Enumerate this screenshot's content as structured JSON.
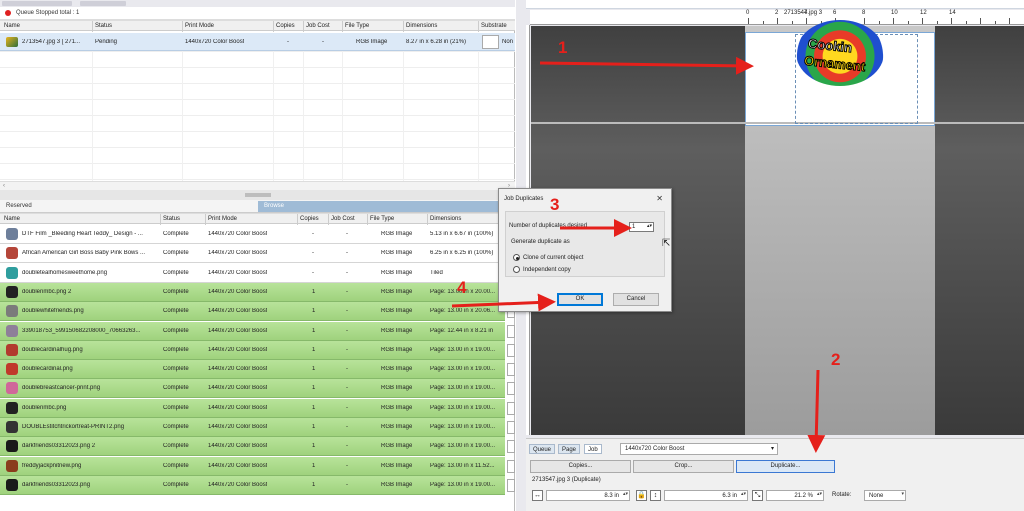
{
  "queue": {
    "status_text": "Queue Stopped   total : 1",
    "columns": [
      "Name",
      "Status",
      "Print Mode",
      "Copies",
      "Job Cost",
      "File Type",
      "Dimensions",
      "Substrate"
    ],
    "row": {
      "name": "2713547.jpg 3 [ 271...",
      "status": "Pending",
      "print_mode": "1440x720 Color Boost",
      "copies": "-",
      "job_cost": "-",
      "file_type": "RGB Image",
      "dimensions": "8.27 in x 6.28 in (21%)",
      "substrate": "Non"
    }
  },
  "tabs": {
    "reserved": "Reserved",
    "browse": "Browse"
  },
  "jobs": {
    "columns": [
      "Name",
      "Status",
      "Print Mode",
      "Copies",
      "Job Cost",
      "File Type",
      "Dimensions"
    ],
    "rows": [
      {
        "name": "DTF Film _Bleeding Heart Teddy_ Design - ...",
        "status": "Complete",
        "mode": "1440x720 Color Boost",
        "copies": "-",
        "cost": "-",
        "type": "RGB Image",
        "dim": "5.13 in x 6.67 in (100%)",
        "green": false,
        "icon": "#6e7f9b"
      },
      {
        "name": "African American Girl Boss Baby Pink Bows ...",
        "status": "Complete",
        "mode": "1440x720 Color Boost",
        "copies": "-",
        "cost": "-",
        "type": "RGB Image",
        "dim": "6.25 in x 6.25 in (100%)",
        "green": false,
        "icon": "#b5463a"
      },
      {
        "name": "doubletealhomesweethome.png",
        "status": "Complete",
        "mode": "1440x720 Color Boost",
        "copies": "-",
        "cost": "-",
        "type": "RGB Image",
        "dim": "Tiled",
        "green": false,
        "icon": "#2f9e9e"
      },
      {
        "name": "doublenmbc.png 2",
        "status": "Complete",
        "mode": "1440x720 Color Boost",
        "copies": "1",
        "cost": "-",
        "type": "RGB Image",
        "dim": "Page: 13.00 in x 20.00...",
        "green": true,
        "icon": "#222222"
      },
      {
        "name": "doublewhitefriends.png",
        "status": "Complete",
        "mode": "1440x720 Color Boost",
        "copies": "1",
        "cost": "-",
        "type": "RGB Image",
        "dim": "Page: 13.00 in x 20.06...",
        "green": true,
        "icon": "#7b7b7b"
      },
      {
        "name": "339018753_599150682208000_70663263...",
        "status": "Complete",
        "mode": "1440x720 Color Boost",
        "copies": "1",
        "cost": "-",
        "type": "RGB Image",
        "dim": "Page: 12.44 in x 8.21 in",
        "green": true,
        "icon": "#8e7f99"
      },
      {
        "name": "doublecardinalhug.png",
        "status": "Complete",
        "mode": "1440x720 Color Boost",
        "copies": "1",
        "cost": "-",
        "type": "RGB Image",
        "dim": "Page: 13.00 in x 19.00...",
        "green": true,
        "icon": "#b23a2e"
      },
      {
        "name": "doublecardinal.png",
        "status": "Complete",
        "mode": "1440x720 Color Boost",
        "copies": "1",
        "cost": "-",
        "type": "RGB Image",
        "dim": "Page: 13.00 in x 19.00...",
        "green": true,
        "icon": "#c0392b"
      },
      {
        "name": "doublebreastcancer-print.png",
        "status": "Complete",
        "mode": "1440x720 Color Boost",
        "copies": "1",
        "cost": "-",
        "type": "RGB Image",
        "dim": "Page: 13.00 in x 19.00...",
        "green": true,
        "icon": "#d0679a"
      },
      {
        "name": "doublenmbc.png",
        "status": "Complete",
        "mode": "1440x720 Color Boost",
        "copies": "1",
        "cost": "-",
        "type": "RGB Image",
        "dim": "Page: 13.00 in x 19.00...",
        "green": true,
        "icon": "#222222"
      },
      {
        "name": "DOUBLEstitchtrickortreat-PRINT2.png",
        "status": "Complete",
        "mode": "1440x720 Color Boost",
        "copies": "1",
        "cost": "-",
        "type": "RGB Image",
        "dim": "Page: 13.00 in x 19.00...",
        "green": true,
        "icon": "#333333"
      },
      {
        "name": "darkfriends03312023.png 2",
        "status": "Complete",
        "mode": "1440x720 Color Boost",
        "copies": "1",
        "cost": "-",
        "type": "RGB Image",
        "dim": "Page: 13.00 in x 19.00...",
        "green": true,
        "icon": "#1a1a1a"
      },
      {
        "name": "freddyjackpnitnew.png",
        "status": "Complete",
        "mode": "1440x720 Color Boost",
        "copies": "1",
        "cost": "-",
        "type": "RGB Image",
        "dim": "Page: 13.00 in x 11.52...",
        "green": true,
        "icon": "#8a3d1c"
      },
      {
        "name": "darkfriends03312023.png",
        "status": "Complete",
        "mode": "1440x720 Color Boost",
        "copies": "1",
        "cost": "-",
        "type": "RGB Image",
        "dim": "Page: 13.00 in x 19.00...",
        "green": true,
        "icon": "#1a1a1a"
      }
    ]
  },
  "preview": {
    "ruler_numbers": [
      "0",
      "2",
      "4",
      "6",
      "8",
      "10",
      "12",
      "14"
    ],
    "page_label": "2713547.jpg 3",
    "logo_line1": "Cookin",
    "logo_line2": "Ornament"
  },
  "dialog": {
    "title": "Job Duplicates",
    "close": "✕",
    "num_label": "Number of duplicates desired",
    "num_value": "1",
    "generate_label": "Generate duplicate as",
    "opt_clone": "Clone of current object",
    "opt_independent": "Independent copy",
    "ok": "OK",
    "cancel": "Cancel"
  },
  "bottom": {
    "tabs": [
      "Queue",
      "Page",
      "Job"
    ],
    "print_mode": "1440x720 Color Boost",
    "copies_btn": "Copies...",
    "crop_btn": "Crop...",
    "duplicate_btn": "Duplicate...",
    "job_name": "2713547.jpg 3 (Duplicate)",
    "width": "8.3 in",
    "height": "6.3 in",
    "scale": "21.2 %",
    "rotate_label": "Rotate:",
    "rotate_value": "None"
  },
  "annotations": {
    "n1": "1",
    "n2": "2",
    "n3": "3",
    "n4": "4",
    "color": "#e5201b"
  }
}
